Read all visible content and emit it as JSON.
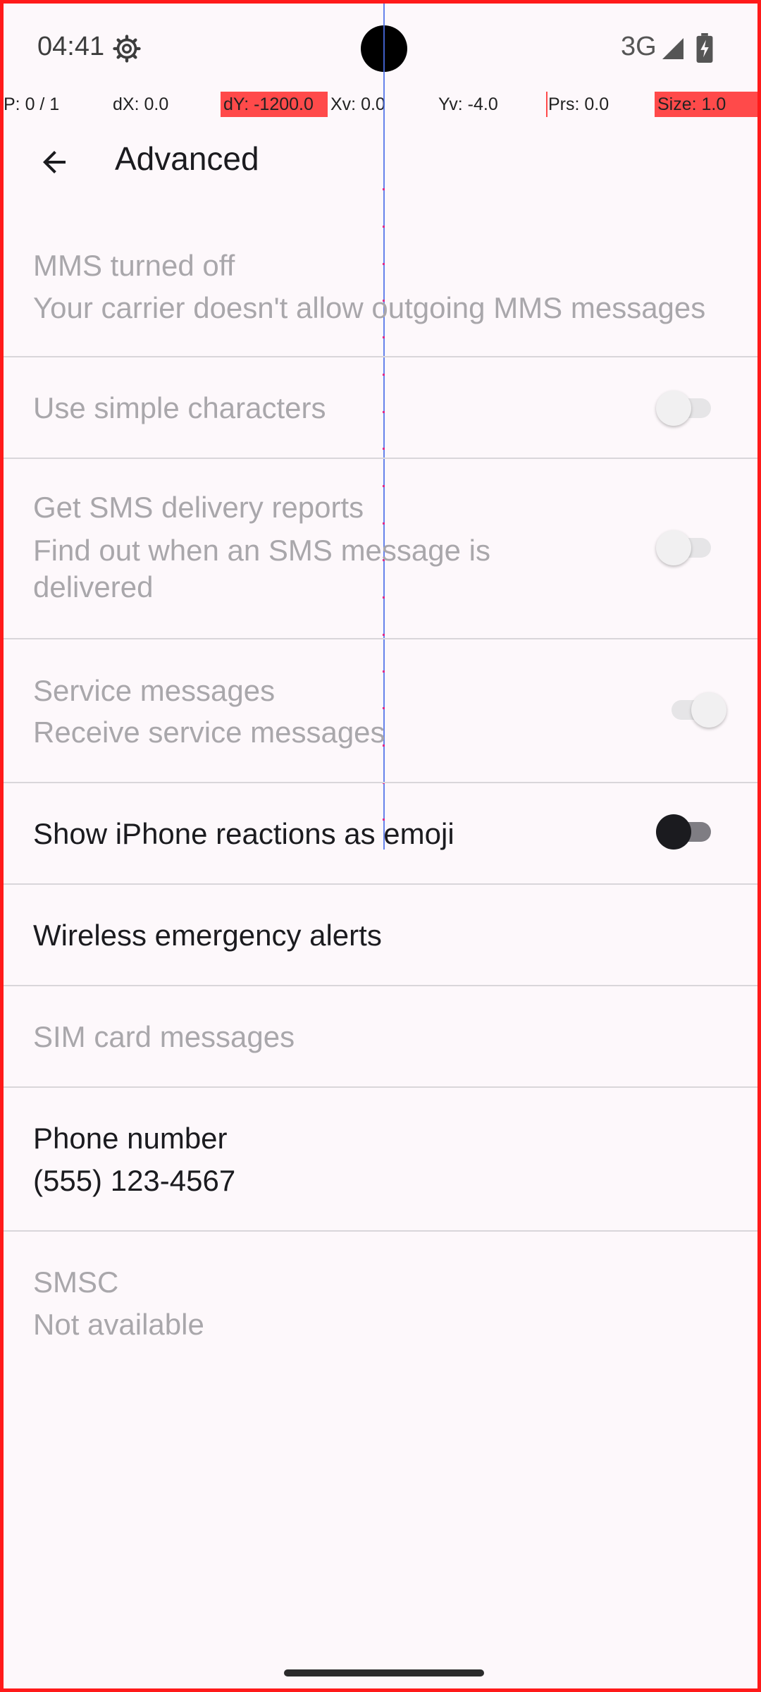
{
  "status_bar": {
    "time": "04:41",
    "network": "3G",
    "settings_icon": "gear-icon",
    "signal_icon": "signal-icon",
    "battery_icon": "battery-charging-icon"
  },
  "debug_overlay": {
    "pointer": "P: 0 / 1",
    "dx": "dX: 0.0",
    "dy": "dY: -1200.0",
    "xv": "Xv: 0.0",
    "yv": "Yv: -4.0",
    "prs": "Prs: 0.0",
    "size": "Size: 1.0",
    "highlight_color": "#ff4a4a"
  },
  "app_bar": {
    "title": "Advanced",
    "back_icon": "arrow-back-icon"
  },
  "settings": {
    "mms": {
      "title": "MMS turned off",
      "summary": "Your carrier doesn't allow outgoing MMS messages"
    },
    "simple_chars": {
      "title": "Use simple characters",
      "checked": false
    },
    "sms_reports": {
      "title": "Get SMS delivery reports",
      "summary": "Find out when an SMS message is delivered",
      "checked": false
    },
    "service_messages": {
      "title": "Service messages",
      "summary": "Receive service messages",
      "checked": true
    },
    "iphone_reactions": {
      "title": "Show iPhone reactions as emoji",
      "checked": false
    },
    "emergency_alerts": {
      "title": "Wireless emergency alerts"
    },
    "sim_messages": {
      "title": "SIM card messages"
    },
    "phone_number": {
      "title": "Phone number",
      "value": "(555) 123-4567"
    },
    "smsc": {
      "title": "SMSC",
      "value": "Not available"
    }
  },
  "colors": {
    "background": "#fdf8fb",
    "text_primary": "#1b1b1f",
    "text_disabled": "#a9a7ab",
    "frame_border": "#ff1a1a"
  }
}
